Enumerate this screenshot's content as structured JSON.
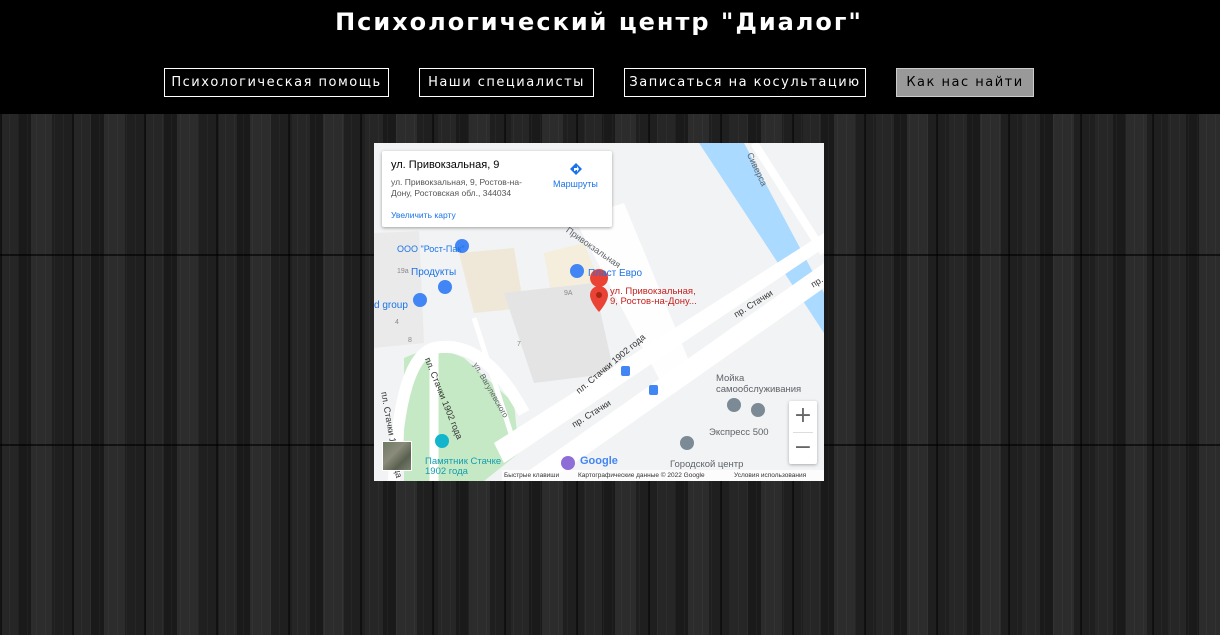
{
  "header": {
    "title": "Психологический центр \"Диалог\""
  },
  "nav": {
    "help": "Психологическая помощь",
    "specialists": "Наши специалисты",
    "appointment": "Записаться на косультацию",
    "find_us": "Как нас найти"
  },
  "map": {
    "card": {
      "title": "ул. Привокзальная, 9",
      "address": "ул. Привокзальная, 9, Ростов-на-Дону, Ростовская обл., 344034",
      "routes": "Маршруты",
      "enlarge": "Увеличить карту"
    },
    "marker_label_1": "ул. Привокзальная,",
    "marker_label_2": "9, Ростов-на-Дону...",
    "labels": {
      "rost_pak": "ООО \"Рост-Пак\"",
      "produkty": "Продукты",
      "d_group": "d group",
      "plast_evro": "Пласт Евро",
      "privokzalnaya_street": "Привокзальная",
      "siversa": "Сиверса",
      "stachki_1": "пр. Стачки",
      "stachki_2": "пр. Стачки",
      "stachki_short": "пр.",
      "pl_stachki_1": "пл. Стачки 1902 года",
      "pl_stachki_2": "пл. Стачки 1902 года",
      "pl_stachki_3": "пл. Стачки 1902 года",
      "vagulevsky": "ул. Вагулевского",
      "moyka_1": "Мойка",
      "moyka_2": "самообслуживания",
      "express": "Экспресс 500",
      "gorodskoy": "Городской центр",
      "monument_1": "Памятник Стачке",
      "monument_2": "1902 года",
      "num_19a": "19а",
      "num_9a": "9А",
      "num_4": "4",
      "num_8": "8",
      "num_7": "7",
      "google": "Google"
    },
    "zoom_in": "+",
    "zoom_out": "−",
    "footer": {
      "shortcuts": "Быстрые клавиши",
      "data": "Картографические данные © 2022 Google",
      "terms": "Условия использования"
    }
  },
  "colors": {
    "header_bg": "#000000",
    "accent_marker": "#ea4335",
    "poi_blue": "#4285f4",
    "water": "#aadaff",
    "park": "#c5e8c5"
  }
}
